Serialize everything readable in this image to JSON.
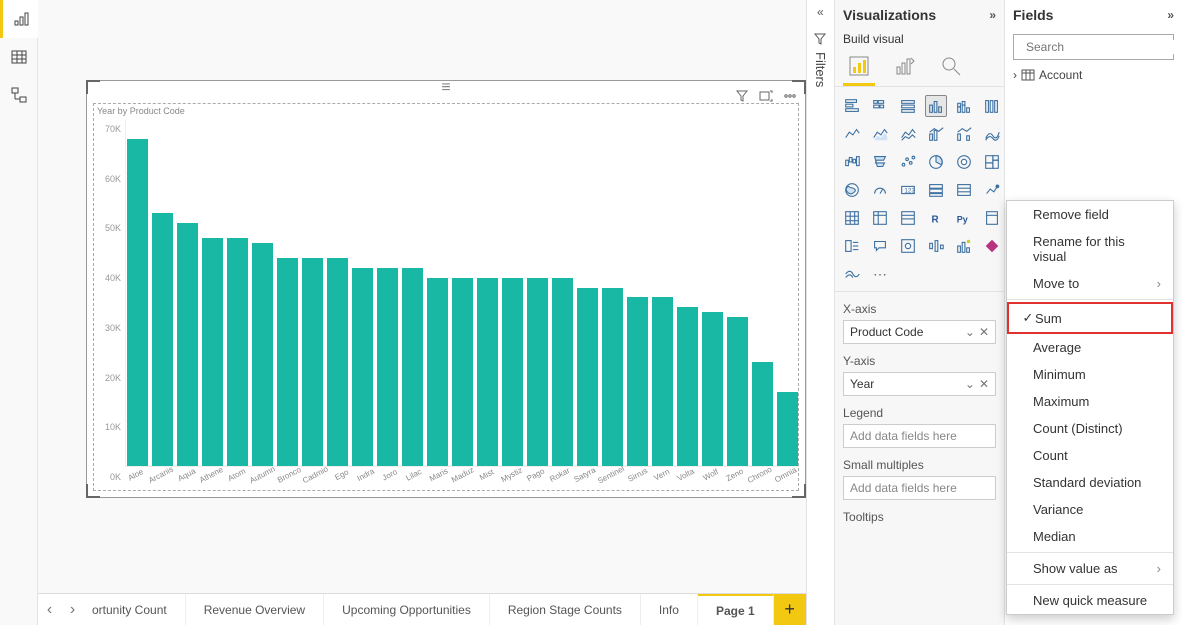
{
  "view_modes": [
    "report",
    "data",
    "model"
  ],
  "panes": {
    "visualizations": {
      "title": "Visualizations",
      "subtitle": "Build visual"
    },
    "fields": {
      "title": "Fields"
    },
    "filters_label": "Filters"
  },
  "search": {
    "placeholder": "Search"
  },
  "fields_tree": {
    "tables": [
      {
        "name": "Account"
      }
    ]
  },
  "field_wells": {
    "xaxis": {
      "label": "X-axis",
      "value": "Product Code"
    },
    "yaxis": {
      "label": "Y-axis",
      "value": "Year"
    },
    "legend": {
      "label": "Legend",
      "placeholder": "Add data fields here"
    },
    "small_multiples": {
      "label": "Small multiples",
      "placeholder": "Add data fields here"
    },
    "tooltips": {
      "label": "Tooltips"
    }
  },
  "page_tabs": {
    "tabs": [
      {
        "label": "ortunity Count",
        "active": false,
        "clipped": true
      },
      {
        "label": "Revenue Overview",
        "active": false
      },
      {
        "label": "Upcoming Opportunities",
        "active": false
      },
      {
        "label": "Region Stage Counts",
        "active": false
      },
      {
        "label": "Info",
        "active": false
      },
      {
        "label": "Page 1",
        "active": true
      }
    ]
  },
  "context_menu": {
    "items": [
      {
        "label": "Remove field",
        "type": "item"
      },
      {
        "label": "Rename for this visual",
        "type": "item"
      },
      {
        "label": "Move to",
        "type": "submenu"
      },
      {
        "type": "sep"
      },
      {
        "label": "Sum",
        "type": "check",
        "checked": true,
        "highlight": true
      },
      {
        "label": "Average",
        "type": "check"
      },
      {
        "label": "Minimum",
        "type": "check"
      },
      {
        "label": "Maximum",
        "type": "check"
      },
      {
        "label": "Count (Distinct)",
        "type": "check"
      },
      {
        "label": "Count",
        "type": "check"
      },
      {
        "label": "Standard deviation",
        "type": "check"
      },
      {
        "label": "Variance",
        "type": "check"
      },
      {
        "label": "Median",
        "type": "check"
      },
      {
        "type": "sep"
      },
      {
        "label": "Show value as",
        "type": "submenu"
      },
      {
        "type": "sep"
      },
      {
        "label": "New quick measure",
        "type": "item"
      }
    ]
  },
  "chart_data": {
    "type": "bar",
    "title": "Year by Product Code",
    "xlabel": "",
    "ylabel": "",
    "ylim": [
      0,
      70000
    ],
    "y_ticks": [
      "0K",
      "10K",
      "20K",
      "30K",
      "40K",
      "50K",
      "60K",
      "70K"
    ],
    "categories": [
      "Aloe",
      "Arcanis",
      "Aqua",
      "Athene",
      "Atom",
      "Autumn",
      "Bronco",
      "Cadmio",
      "Ego",
      "Indra",
      "Joro",
      "Lilac",
      "Maris",
      "Maduz",
      "Mist",
      "Mystiz",
      "Pago",
      "Rokar",
      "Satyra",
      "Sentinel",
      "Sirrus",
      "Vern",
      "Volta",
      "Wolf",
      "Zeno",
      "Chrono",
      "Omnia"
    ],
    "values": [
      66000,
      51000,
      49000,
      46000,
      46000,
      45000,
      42000,
      42000,
      42000,
      40000,
      40000,
      40000,
      38000,
      38000,
      38000,
      38000,
      38000,
      38000,
      36000,
      36000,
      34000,
      34000,
      32000,
      31000,
      30000,
      21000,
      15000
    ]
  }
}
